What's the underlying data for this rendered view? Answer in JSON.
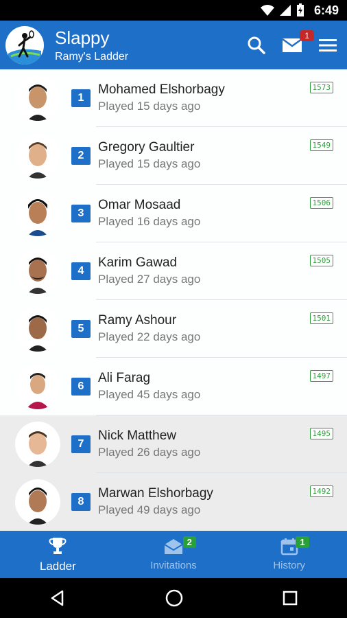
{
  "status_bar": {
    "time": "6:49"
  },
  "app_bar": {
    "title": "Slappy",
    "subtitle": "Ramy's Ladder",
    "mail_badge": "1"
  },
  "players": [
    {
      "rank": "1",
      "name": "Mohamed Elshorbagy",
      "played": "Played 15 days ago",
      "rating": "1573"
    },
    {
      "rank": "2",
      "name": "Gregory Gaultier",
      "played": "Played 15 days ago",
      "rating": "1549"
    },
    {
      "rank": "3",
      "name": "Omar Mosaad",
      "played": "Played 16 days ago",
      "rating": "1506"
    },
    {
      "rank": "4",
      "name": "Karim Gawad",
      "played": "Played 27 days ago",
      "rating": "1505"
    },
    {
      "rank": "5",
      "name": "Ramy Ashour",
      "played": "Played 22 days ago",
      "rating": "1501"
    },
    {
      "rank": "6",
      "name": "Ali Farag",
      "played": "Played 45 days ago",
      "rating": "1497"
    },
    {
      "rank": "7",
      "name": "Nick Matthew",
      "played": "Played 26 days ago",
      "rating": "1495"
    },
    {
      "rank": "8",
      "name": "Marwan Elshorbagy",
      "played": "Played 49 days ago",
      "rating": "1492"
    }
  ],
  "bottom_nav": {
    "ladder": {
      "label": "Ladder"
    },
    "invitations": {
      "label": "Invitations",
      "badge": "2"
    },
    "history": {
      "label": "History",
      "badge": "1"
    }
  },
  "colors": {
    "primary": "#1e6fc8",
    "badge_red": "#c62828",
    "badge_green": "#2aa138",
    "rating_green": "#2e9e3c"
  },
  "icons": [
    "wifi-icon",
    "signal-icon",
    "battery-icon",
    "search-icon",
    "mail-icon",
    "menu-icon",
    "trophy-icon",
    "invitation-envelope-icon",
    "calendar-icon",
    "back-icon",
    "home-icon",
    "recents-icon"
  ]
}
